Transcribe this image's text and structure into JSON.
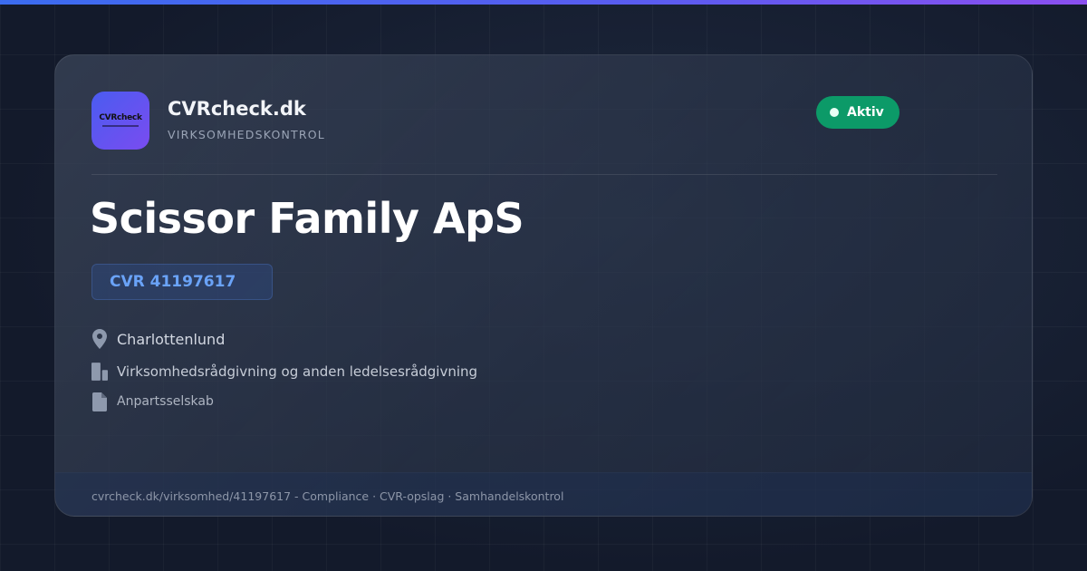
{
  "brand": {
    "logo_text": "CVRcheck",
    "name": "CVRcheck.dk",
    "tagline": "VIRKSOMHEDSKONTROL"
  },
  "status": {
    "label": "Aktiv",
    "color": "#0c9a68"
  },
  "company": {
    "name": "Scissor Family ApS",
    "cvr_label": "CVR 41197617",
    "location": "Charlottenlund",
    "industry": "Virksomhedsrådgivning og anden ledelsesrådgivning",
    "company_type": "Anpartsselskab"
  },
  "icons": {
    "location": "map-pin-icon",
    "industry": "building-icon",
    "company_type": "document-icon"
  },
  "footer": {
    "text": "cvrcheck.dk/virksomhed/41197617 - Compliance · CVR-opslag · Samhandelskontrol"
  },
  "colors": {
    "accent_blue": "#6aa3f8",
    "top_bar_start": "#3b6cf0",
    "top_bar_end": "#8b4ff0",
    "background": "#141c2e"
  }
}
